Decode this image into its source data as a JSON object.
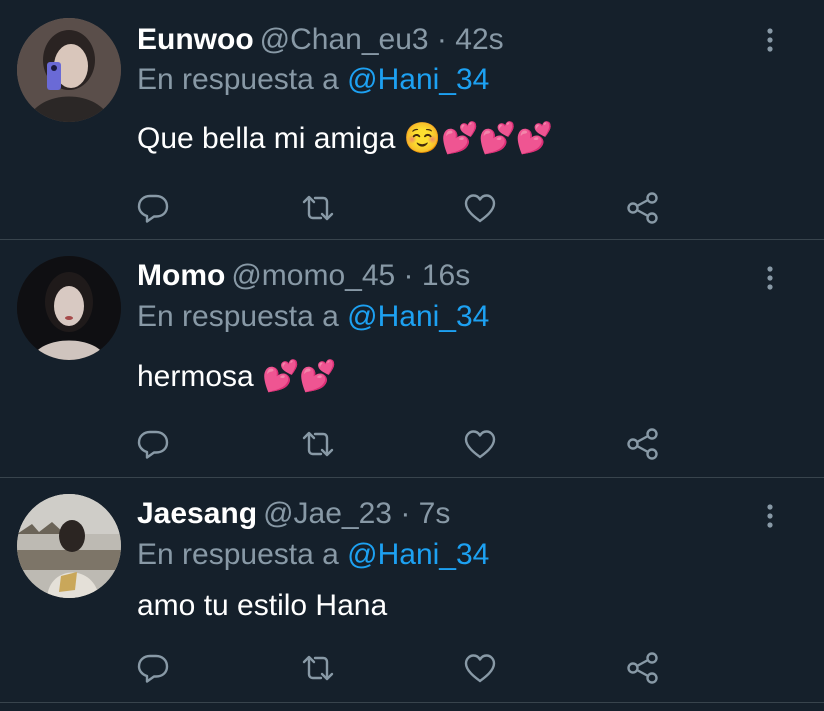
{
  "tweets": [
    {
      "name": "Eunwoo",
      "handle": "@Chan_eu3",
      "separator": "·",
      "time": "42s",
      "reply_prefix": "En respuesta a",
      "reply_to": "@Hani_34",
      "text": "Que bella mi amiga ☺️💕💕💕"
    },
    {
      "name": "Momo",
      "handle": "@momo_45",
      "separator": "·",
      "time": "16s",
      "reply_prefix": "En respuesta a",
      "reply_to": "@Hani_34",
      "text": "hermosa 💕💕"
    },
    {
      "name": "Jaesang",
      "handle": "@Jae_23",
      "separator": "·",
      "time": "7s",
      "reply_prefix": "En respuesta a",
      "reply_to": "@Hani_34",
      "text": "amo tu estilo Hana"
    }
  ],
  "icons": {
    "reply": "reply-icon",
    "retweet": "retweet-icon",
    "like": "heart-icon",
    "share": "share-icon",
    "more": "more-vertical-icon"
  },
  "colors": {
    "background": "#15202b",
    "name": "#ffffff",
    "secondary_text": "#8899a6",
    "mention": "#1da1f2",
    "divider": "#38444d"
  }
}
